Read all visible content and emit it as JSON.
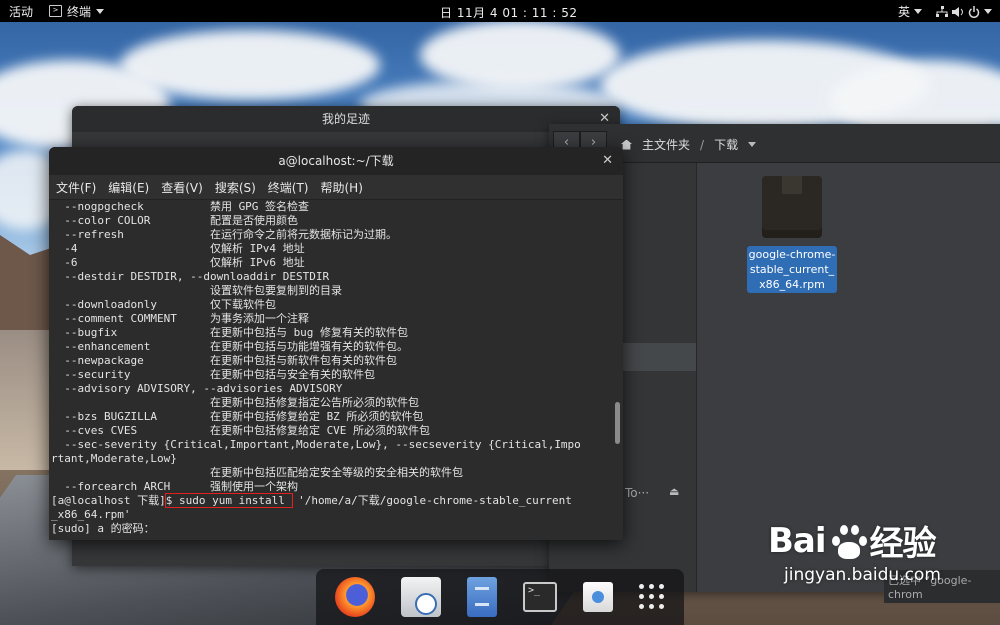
{
  "topbar": {
    "activities": "活动",
    "app_menu": "终端",
    "clock": "日 11月 4  01 : 11 : 52",
    "input_method": "英"
  },
  "file_manager": {
    "back_window_title": "我的足迹",
    "breadcrumb_home": "主文件夹",
    "breadcrumb_current": "下载",
    "file_name": "google-chrome-stable_current_x86_64.rpm",
    "file_name_lines": [
      "google-chrome-",
      "stable_current_",
      "x86_64.rpm"
    ],
    "sidebar_partial": "To···",
    "status_partial": "已选中 “google-chrom"
  },
  "terminal": {
    "title": "a@localhost:~/下载",
    "menu": [
      "文件(F)",
      "编辑(E)",
      "查看(V)",
      "搜索(S)",
      "终端(T)",
      "帮助(H)"
    ],
    "lines": [
      "  --nogpgcheck          禁用 GPG 签名检查",
      "  --color COLOR         配置是否使用颜色",
      "  --refresh             在运行命令之前将元数据标记为过期。",
      "  -4                    仅解析 IPv4 地址",
      "  -6                    仅解析 IPv6 地址",
      "  --destdir DESTDIR, --downloaddir DESTDIR",
      "                        设置软件包要复制到的目录",
      "  --downloadonly        仅下载软件包",
      "  --comment COMMENT     为事务添加一个注释",
      "  --bugfix              在更新中包括与 bug 修复有关的软件包",
      "  --enhancement         在更新中包括与功能增强有关的软件包。",
      "  --newpackage          在更新中包括与新软件包有关的软件包",
      "  --security            在更新中包括与安全有关的软件包",
      "  --advisory ADVISORY, --advisories ADVISORY",
      "                        在更新中包括修复指定公告所必须的软件包",
      "  --bzs BUGZILLA        在更新中包括修复给定 BZ 所必须的软件包",
      "  --cves CVES           在更新中包括修复给定 CVE 所必须的软件包",
      "  --sec-severity {Critical,Important,Moderate,Low}, --secseverity {Critical,Impo",
      "rtant,Moderate,Low}",
      "                        在更新中包括匹配给定安全等级的安全相关的软件包",
      "  --forcearch ARCH      强制使用一个架构"
    ],
    "prompt": "[a@localhost 下载]",
    "command_highlight": "$ sudo yum install ",
    "command_rest": " '/home/a/下载/google-chrome-stable_current",
    "command_wrap": "_x86_64.rpm'",
    "sudo_prompt": "[sudo] a 的密码："
  },
  "dock": {
    "items": [
      "firefox-icon",
      "clock-icon",
      "file-cabinet-icon",
      "terminal-icon",
      "software-store-icon",
      "show-apps-icon"
    ],
    "terminal_glyph": ">_"
  },
  "watermark": {
    "brand_left": "Bai",
    "brand_right": "经验",
    "domain": "jingyan.baidu.com"
  }
}
